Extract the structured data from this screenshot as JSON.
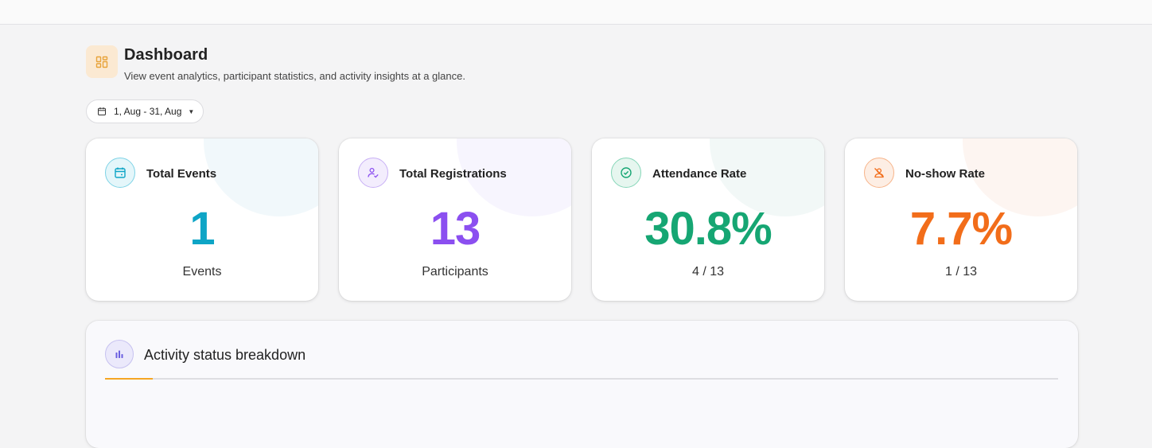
{
  "header": {
    "title": "Dashboard",
    "subtitle": "View event analytics, participant statistics, and activity insights at a glance.",
    "icon": "dashboard-grid-icon"
  },
  "date_filter": {
    "label": "1, Aug - 31, Aug",
    "icon": "calendar-icon"
  },
  "cards": [
    {
      "title": "Total Events",
      "value": "1",
      "sub": "Events",
      "icon": "calendar-icon",
      "color": "#0ea5c6"
    },
    {
      "title": "Total Registrations",
      "value": "13",
      "sub": "Participants",
      "icon": "user-check-icon",
      "color": "#8b4ff0"
    },
    {
      "title": "Attendance Rate",
      "value": "30.8%",
      "sub": "4 / 13",
      "icon": "check-circle-icon",
      "color": "#16a673"
    },
    {
      "title": "No-show Rate",
      "value": "7.7%",
      "sub": "1 / 13",
      "icon": "user-off-icon",
      "color": "#f26d1a"
    }
  ],
  "panel": {
    "title": "Activity status breakdown",
    "icon": "bar-chart-icon",
    "accent": "#f5a623"
  }
}
